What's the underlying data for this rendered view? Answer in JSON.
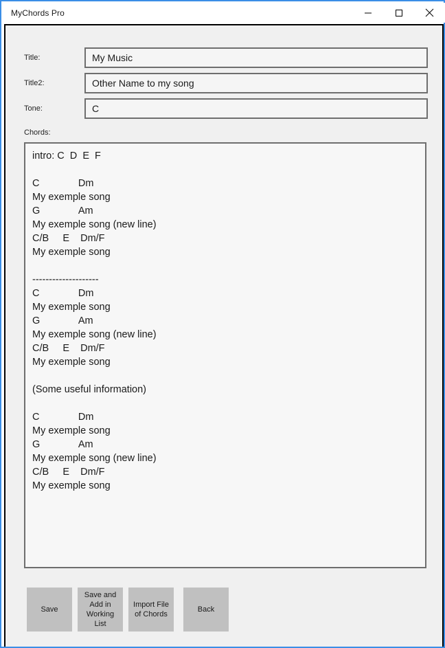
{
  "window": {
    "title": "MyChords Pro",
    "accent_border_color": "#3a8ee6",
    "client_background": "#f0f0f0",
    "controls": [
      {
        "name": "minimize",
        "icon": "minimize-icon"
      },
      {
        "name": "maximize",
        "icon": "maximize-icon"
      },
      {
        "name": "close",
        "icon": "close-icon"
      }
    ]
  },
  "form": {
    "fields": [
      {
        "label": "Title:",
        "value": "My Music",
        "placeholder": ""
      },
      {
        "label": "Title2:",
        "value": "Other Name to my song",
        "placeholder": ""
      },
      {
        "label": "Tone:",
        "value": "C",
        "placeholder": ""
      }
    ],
    "chords_label": "Chords:",
    "chords_value": "intro: C  D  E  F\n\nC              Dm\nMy exemple song\nG              Am\nMy exemple song (new line)\nC/B     E    Dm/F\nMy exemple song\n\n--------------------\nC              Dm\nMy exemple song\nG              Am\nMy exemple song (new line)\nC/B     E    Dm/F\nMy exemple song\n\n(Some useful information)\n\nC              Dm\nMy exemple song\nG              Am\nMy exemple song (new line)\nC/B     E    Dm/F\nMy exemple song",
    "chords_placeholder": ""
  },
  "buttons": [
    {
      "name": "save",
      "label": "Save"
    },
    {
      "name": "save-and-add-in-working-list",
      "label": "Save and Add in Working List"
    },
    {
      "name": "import-file-of-chords",
      "label": "Import File of Chords"
    },
    {
      "name": "back",
      "label": "Back"
    }
  ],
  "colors": {
    "button_face": "#c0c0c0",
    "input_border": "#6e6e6e",
    "input_background": "#f5f5f5"
  }
}
